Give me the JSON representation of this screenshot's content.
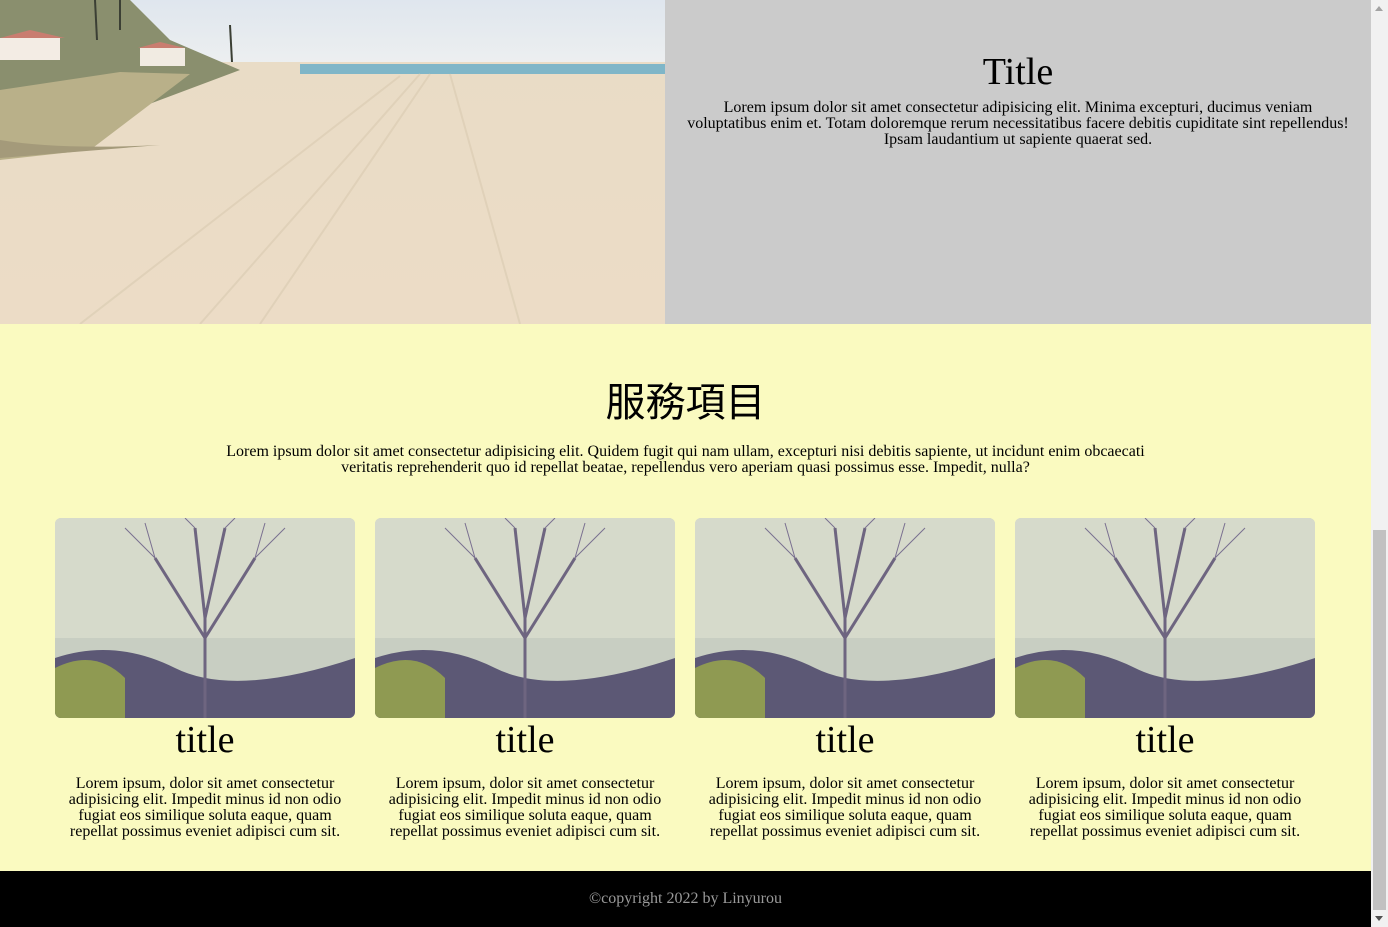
{
  "hero": {
    "title": "Title",
    "body": "Lorem ipsum dolor sit amet consectetur adipisicing elit. Minima excepturi, ducimus veniam voluptatibus enim et. Totam doloremque rerum necessitatibus facere debitis cupiditate sint repellendus! Ipsam laudantium ut sapiente quaerat sed."
  },
  "services": {
    "title": "服務項目",
    "body": "Lorem ipsum dolor sit amet consectetur adipisicing elit. Quidem fugit qui nam ullam, excepturi nisi debitis sapiente, ut incidunt enim obcaecati veritatis reprehenderit quo id repellat beatae, repellendus vero aperiam quasi possimus esse. Impedit, nulla?",
    "cards": [
      {
        "title": "title",
        "body": "Lorem ipsum, dolor sit amet consectetur adipisicing elit. Impedit minus id non odio fugiat eos similique soluta eaque, quam repellat possimus eveniet adipisci cum sit."
      },
      {
        "title": "title",
        "body": "Lorem ipsum, dolor sit amet consectetur adipisicing elit. Impedit minus id non odio fugiat eos similique soluta eaque, quam repellat possimus eveniet adipisci cum sit."
      },
      {
        "title": "title",
        "body": "Lorem ipsum, dolor sit amet consectetur adipisicing elit. Impedit minus id non odio fugiat eos similique soluta eaque, quam repellat possimus eveniet adipisci cum sit."
      },
      {
        "title": "title",
        "body": "Lorem ipsum, dolor sit amet consectetur adipisicing elit. Impedit minus id non odio fugiat eos similique soluta eaque, quam repellat possimus eveniet adipisci cum sit."
      }
    ]
  },
  "footer": {
    "copyright": "©copyright 2022 by Linyurou"
  }
}
